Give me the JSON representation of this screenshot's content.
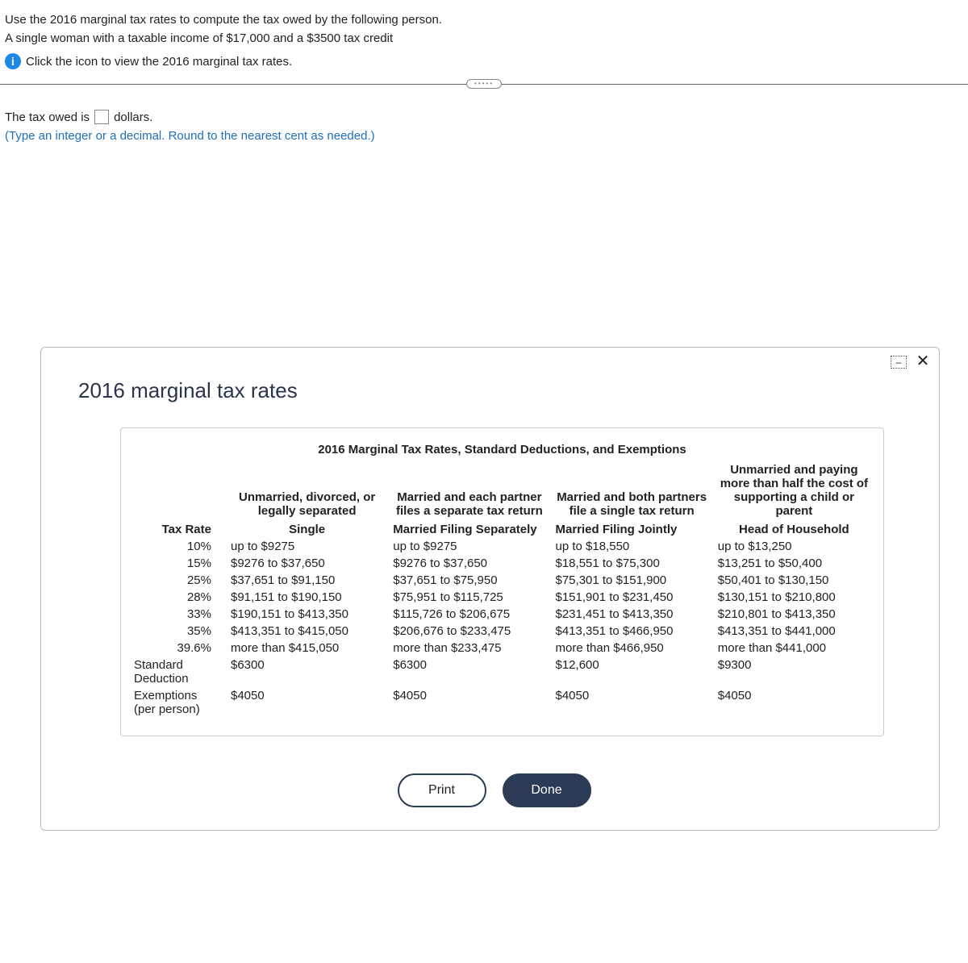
{
  "question": {
    "line1": "Use the 2016 marginal tax rates to compute the tax owed by the following person.",
    "line2": "A single woman with a taxable income of $17,000 and a $3500 tax credit",
    "info_text": "Click the icon to view the 2016 marginal tax rates."
  },
  "answer": {
    "prefix": "The tax owed is",
    "suffix": "dollars.",
    "value": "",
    "hint": "(Type an integer or a decimal. Round to the nearest cent as needed.)"
  },
  "modal": {
    "title": "2016 marginal tax rates",
    "table_caption": "2016 Marginal Tax Rates, Standard Deductions, and Exemptions",
    "col_desc": {
      "single": "Unmarried, divorced, or legally separated",
      "mfs": "Married and each partner files a separate tax return",
      "mfj": "Married and both partners file a single tax return",
      "hoh": "Unmarried and paying more than half the cost of supporting a child or parent"
    },
    "headers": {
      "rate": "Tax Rate",
      "single": "Single",
      "mfs": "Married Filing Separately",
      "mfj": "Married Filing Jointly",
      "hoh": "Head of Household"
    },
    "rows": [
      {
        "rate": "10%",
        "single": "up to $9275",
        "mfs": "up to $9275",
        "mfj": "up to $18,550",
        "hoh": "up to $13,250"
      },
      {
        "rate": "15%",
        "single": "$9276 to $37,650",
        "mfs": "$9276 to $37,650",
        "mfj": "$18,551 to $75,300",
        "hoh": "$13,251 to $50,400"
      },
      {
        "rate": "25%",
        "single": "$37,651 to $91,150",
        "mfs": "$37,651 to $75,950",
        "mfj": "$75,301 to $151,900",
        "hoh": "$50,401 to $130,150"
      },
      {
        "rate": "28%",
        "single": "$91,151 to $190,150",
        "mfs": "$75,951 to $115,725",
        "mfj": "$151,901 to $231,450",
        "hoh": "$130,151 to $210,800"
      },
      {
        "rate": "33%",
        "single": "$190,151 to $413,350",
        "mfs": "$115,726 to $206,675",
        "mfj": "$231,451 to $413,350",
        "hoh": "$210,801 to $413,350"
      },
      {
        "rate": "35%",
        "single": "$413,351 to $415,050",
        "mfs": "$206,676 to $233,475",
        "mfj": "$413,351 to $466,950",
        "hoh": "$413,351 to $441,000"
      },
      {
        "rate": "39.6%",
        "single": "more than $415,050",
        "mfs": "more than $233,475",
        "mfj": "more than $466,950",
        "hoh": "more than $441,000"
      }
    ],
    "std_deduction": {
      "label": "Standard Deduction",
      "single": "$6300",
      "mfs": "$6300",
      "mfj": "$12,600",
      "hoh": "$9300"
    },
    "exemptions": {
      "label": "Exemptions (per person)",
      "single": "$4050",
      "mfs": "$4050",
      "mfj": "$4050",
      "hoh": "$4050"
    },
    "buttons": {
      "print": "Print",
      "done": "Done"
    }
  }
}
